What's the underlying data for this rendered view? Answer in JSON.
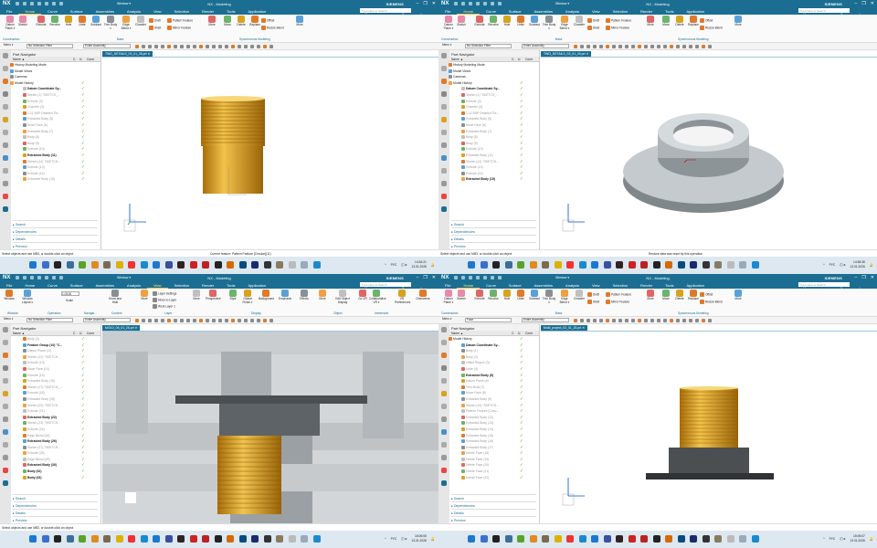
{
  "app": {
    "logo": "NX",
    "title": "NX - Modeling",
    "brand": "SIEMENS",
    "window_menu": "Window ▾",
    "search_placeholder": "Type Here to Search"
  },
  "menu_tabs": [
    "File",
    "Home",
    "Curve",
    "Surface",
    "Assemblies",
    "Analysis",
    "View",
    "Selection",
    "Render",
    "Tools",
    "Application"
  ],
  "home_ribbon": {
    "large": [
      "Datum Plane ▾",
      "Sketch",
      "Extrude",
      "Revolve",
      "Hole",
      "Unite",
      "Subtract",
      "Trim Body ▾",
      "Edge Blend ▾",
      "Chamfer",
      "More",
      "Move",
      "Delete",
      "Replace",
      "More"
    ],
    "small": [
      "Draft",
      "Shell",
      "Pattern Feature",
      "Mirror Feature",
      "Offset",
      "Resize Blend"
    ],
    "groups": [
      "Construction",
      "Base",
      "Synchronous Modeling"
    ]
  },
  "view_ribbon": {
    "large": [
      "Window",
      "Window Layout ▾",
      "Show and Hide",
      "More",
      "More",
      "Perspective",
      "Style",
      "Global Finish ▾",
      "Background",
      "Emphasis",
      "Effects",
      "More",
      "Edit Object Display",
      "Go VR",
      "Collaborative VR ▾",
      "VR Preferences",
      "Omniverse"
    ],
    "small": [
      "Layer Settings",
      "Move to Layer",
      "Work Layer 1"
    ],
    "scale_value": "1.0318",
    "scale_label": "Scale",
    "groups": [
      "Window",
      "Operation",
      "Navigat...",
      "Content",
      "Layer",
      "Display",
      "Object",
      "Immersive"
    ]
  },
  "toolbar": {
    "menu": "Menu ▾",
    "filter_default": "No Selection Filter",
    "filter_face": "Face",
    "scope": "Entire Assembly"
  },
  "navigator": {
    "title": "Part Navigator",
    "columns": [
      "Name ▲",
      "C.",
      "U.",
      "Comr"
    ],
    "sections": [
      "Search",
      "Dependencies",
      "Details",
      "Preview"
    ]
  },
  "colors": {
    "titlebar": "#1b6e92",
    "gold": "#d9a21e",
    "check": "#2ca02c",
    "gray_model": "#b9bfc3"
  },
  "windows": [
    {
      "active_tab": "Home",
      "file_tab": "TWO_DETAILS_03_01_26.prt",
      "filter": "No Selection Filter",
      "status_left": "Select objects and use MB3, or double-click an object",
      "status_center": "Current feature: Pattern Feature [Circular](11)",
      "time": "14:54:21",
      "date": "13.01.2026",
      "lang": "РУС",
      "tree": [
        [
          "History Modeling Mode",
          "n"
        ],
        [
          "Model Views",
          "n"
        ],
        [
          "Cameras",
          "n"
        ],
        [
          "Model History",
          "n"
        ],
        [
          "Datum Coordinate Sy...",
          "b"
        ],
        [
          "Sketch (1) \"SKETCH_...",
          "d"
        ],
        [
          "Extrude (2)",
          "d"
        ],
        [
          "Chamfer (3)",
          "d"
        ],
        [
          "1-11 BSP Detailed Thr...",
          "d"
        ],
        [
          "Extracted Body (5)",
          "d"
        ],
        [
          "Move Face (6)",
          "d"
        ],
        [
          "Extracted Body (7)",
          "d"
        ],
        [
          "Body (8)",
          "d"
        ],
        [
          "Body (9)",
          "d"
        ],
        [
          "Extrude (10)",
          "d"
        ],
        [
          "Extracted Body (11)",
          "b"
        ],
        [
          "Sketch (12) \"SKETCH...",
          "d"
        ],
        [
          "Extrude (13)",
          "d"
        ],
        [
          "Extrude (14)",
          "d"
        ],
        [
          "Extracted Body (15)",
          "d"
        ]
      ]
    },
    {
      "active_tab": "Home",
      "file_tab": "TWO_DETAILS_03_01_26.prt",
      "filter": "No Selection Filter",
      "status_left": "Select objects and use MB3, or double-click an object",
      "status_center": "Restore data was reset by this operation",
      "time": "14:56:36",
      "date": "13.01.2026",
      "lang": "РУС",
      "tree": [
        [
          "History Modeling Mode",
          "n"
        ],
        [
          "Model Views",
          "n"
        ],
        [
          "Cameras",
          "n"
        ],
        [
          "Model History",
          "n"
        ],
        [
          "Datum Coordinate Sy...",
          "b"
        ],
        [
          "Sketch (1) \"SKETCH_...",
          "d"
        ],
        [
          "Extrude (2)",
          "d"
        ],
        [
          "Chamfer (3)",
          "d"
        ],
        [
          "1-11 BSP Detailed Thr...",
          "d"
        ],
        [
          "Extracted Body (5)",
          "d"
        ],
        [
          "Move Face (6)",
          "d"
        ],
        [
          "Extracted Body (7)",
          "d"
        ],
        [
          "Body (8)",
          "d"
        ],
        [
          "Body (9)",
          "d"
        ],
        [
          "Extrude (10)",
          "d"
        ],
        [
          "Extracted Body (11)",
          "d"
        ],
        [
          "Sketch (12) \"SKETCH...",
          "d"
        ],
        [
          "Extrude (13)",
          "d"
        ],
        [
          "Extrude (14)",
          "d"
        ],
        [
          "Extracted Body (15)",
          "b"
        ]
      ]
    },
    {
      "active_tab": "View",
      "file_tab": "MOLD_06_01_26.prt",
      "filter": "No Selection Filter",
      "status_left": "Select objects and use MB3, or double-click an object",
      "status_center": "",
      "time": "16:06:05",
      "date": "13.01.2026",
      "lang": "РУС",
      "tree": [
        [
          "Body (3)",
          "d"
        ],
        [
          "Feature Group (10) \"C...",
          "b"
        ],
        [
          "Datum Plane (11)",
          "d"
        ],
        [
          "Sketch (12) \"SKETCH...",
          "d"
        ],
        [
          "Extrude (13)",
          "d"
        ],
        [
          "Move Face (14)",
          "d"
        ],
        [
          "Extrude (15)",
          "d"
        ],
        [
          "Extracted Body (16)",
          "d"
        ],
        [
          "Sketch (17) \"SKETCH_...",
          "d"
        ],
        [
          "Extrude (18)",
          "d"
        ],
        [
          "Extracted Body (19)",
          "d"
        ],
        [
          "Sketch (20) \"SKETCH...",
          "d"
        ],
        [
          "Extrude (21)",
          "d"
        ],
        [
          "Extracted Body (22)",
          "b"
        ],
        [
          "Sketch (23) \"SKETCH...",
          "d"
        ],
        [
          "Extrude (24)",
          "d"
        ],
        [
          "Edge Blend (25)",
          "d"
        ],
        [
          "Extracted Body (26)",
          "b"
        ],
        [
          "Sketch (27) \"SKETCH...",
          "d"
        ],
        [
          "Extrude (28)",
          "d"
        ],
        [
          "Edge Blend (29)",
          "d"
        ],
        [
          "Extracted Body (30)",
          "b"
        ],
        [
          "Body (32)",
          "b"
        ],
        [
          "Body (33)",
          "b"
        ]
      ]
    },
    {
      "active_tab": "Home",
      "file_tab": "Mold_project_03_01_26.prt",
      "filter": "Face",
      "status_left": "",
      "status_center": "",
      "time": "15:05:07",
      "date": "13.01.2026",
      "lang": "РУС",
      "tree": [
        [
          "Model History",
          "n"
        ],
        [
          "Datum Coordinate Sy...",
          "b"
        ],
        [
          "Body (1)",
          "d"
        ],
        [
          "Body (2)",
          "d"
        ],
        [
          "Offset Region (3)",
          "d"
        ],
        [
          "Unite (4)",
          "d"
        ],
        [
          "Extracted Body (5)",
          "b"
        ],
        [
          "Datum Plane (6)",
          "d"
        ],
        [
          "Trim Body (7)",
          "d"
        ],
        [
          "Move Face (8)",
          "d"
        ],
        [
          "Extracted Body (9)",
          "d"
        ],
        [
          "Sketch (10) \"SKETCH...",
          "d"
        ],
        [
          "Pattern Feature [Circu...",
          "d"
        ],
        [
          "Extracted Body (12)",
          "d"
        ],
        [
          "Extracted Body (13)",
          "d"
        ],
        [
          "Extracted Body (14)",
          "d"
        ],
        [
          "Extracted Body (15)",
          "d"
        ],
        [
          "Extracted Body (16)",
          "d"
        ],
        [
          "Extracted Body (17)",
          "d"
        ],
        [
          "Delete Face (18)",
          "d"
        ],
        [
          "Delete Face (19)",
          "d"
        ],
        [
          "Delete Face (20)",
          "d"
        ],
        [
          "Delete Face (21)",
          "d"
        ],
        [
          "Delete Face (22)",
          "d"
        ]
      ]
    }
  ]
}
